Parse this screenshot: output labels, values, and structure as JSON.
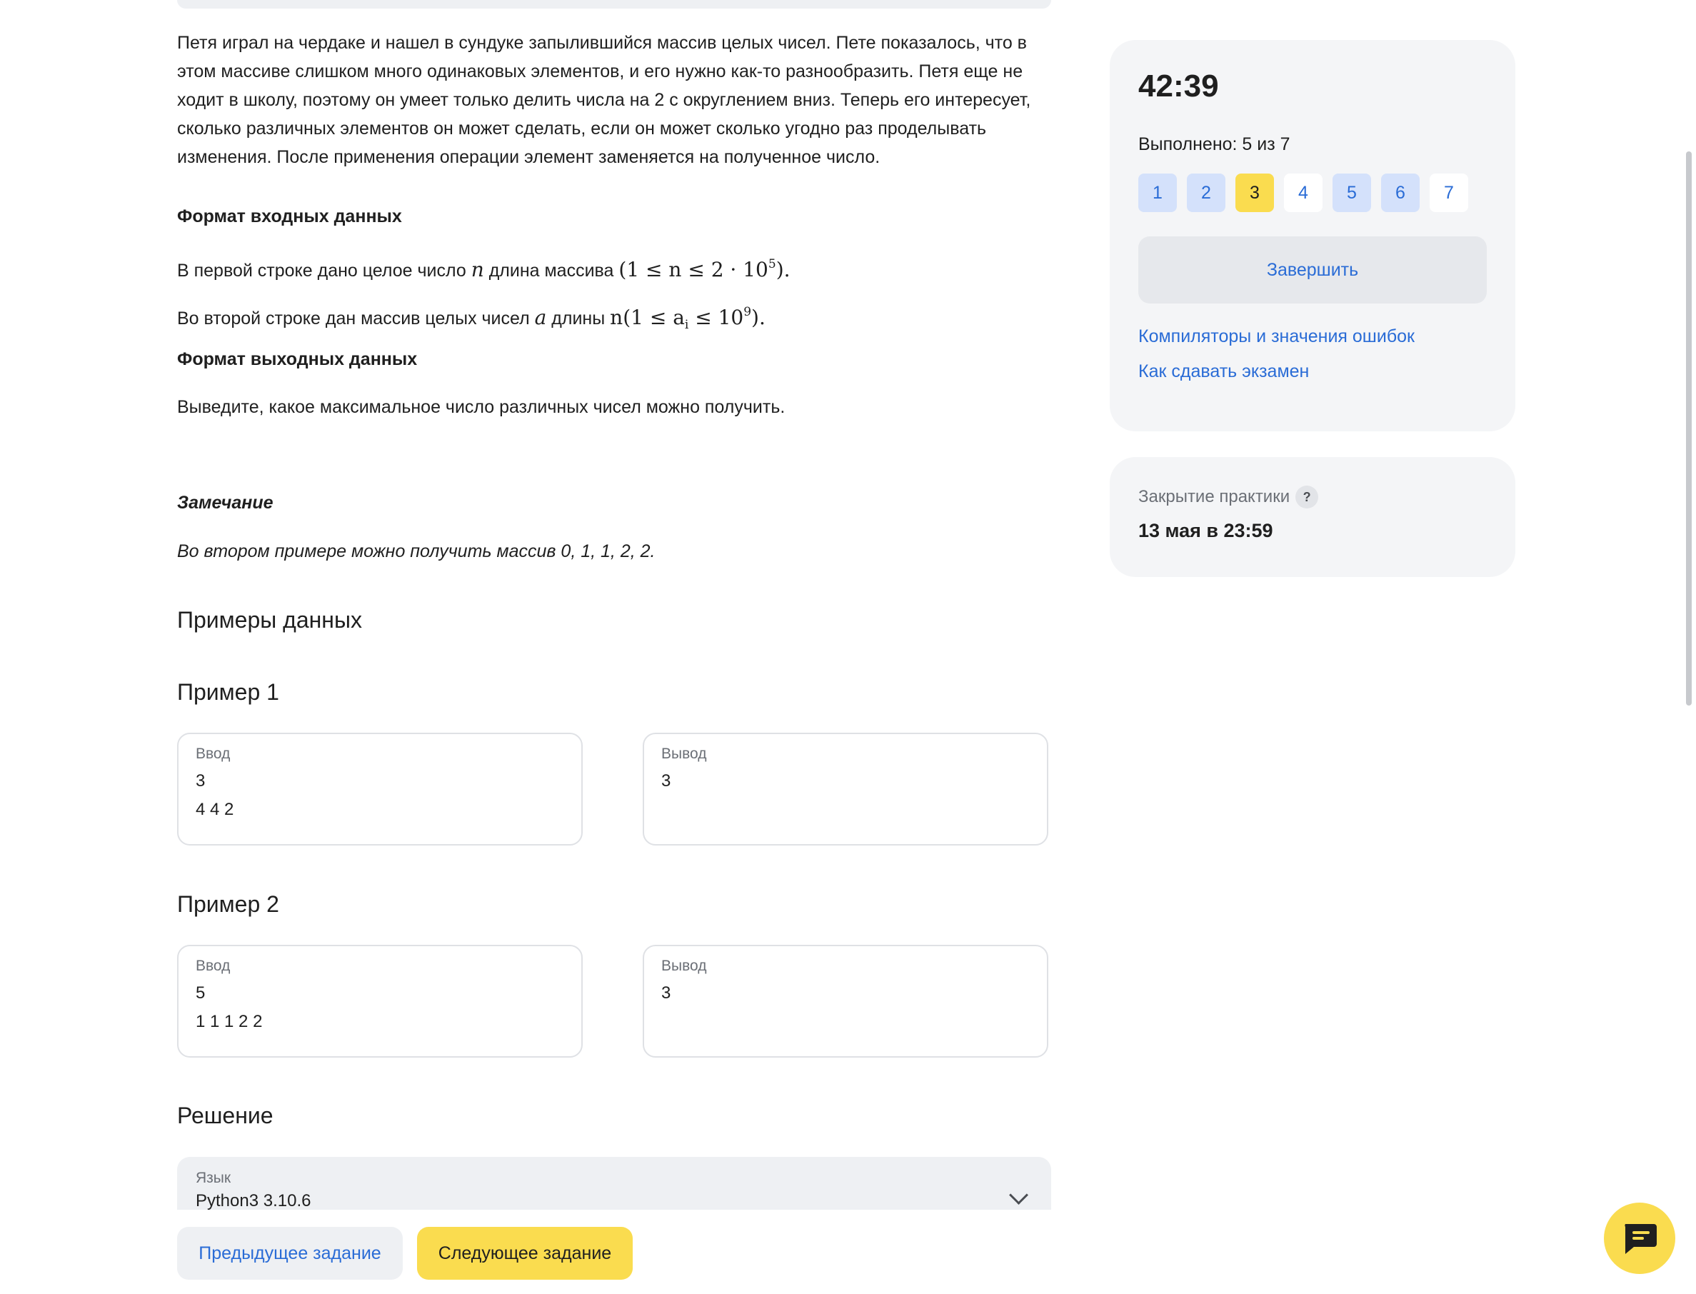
{
  "problem": {
    "statement_lines": [
      "Петя играл на чердаке и нашел в сундуке запылившийся массив целых чисел. Пете показалось, что в",
      "этом массиве слишком много одинаковых элементов, и его нужно как-то разнообразить. Петя еще не",
      "ходит в школу, поэтому он умеет только делить числа на 2 с округлением вниз. Теперь его интересует,",
      "сколько различных элементов он может сделать, если он может сколько угодно раз проделывать",
      "изменения. После применения операции элемент заменяется на полученное число."
    ],
    "input_format_title": "Формат входных данных",
    "input_line1_prefix": "В первой строке дано целое число",
    "input_line1_var": "n",
    "input_line1_mid": "длина массива",
    "input_line1_math": "(1 ≤ n ≤ 2 · 10",
    "input_line1_exp": "5",
    "input_line1_end": ").",
    "input_line2_prefix": "Во второй строке дан массив целых чисел",
    "input_line2_var": "a",
    "input_line2_mid": "длины",
    "input_line2_math": "n(1 ≤ a",
    "input_line2_sub": "i",
    "input_line2_math2": " ≤ 10",
    "input_line2_exp": "9",
    "input_line2_end": ").",
    "output_format_title": "Формат выходных данных",
    "output_line": "Выведите, какое максимальное число различных чисел можно получить.",
    "note_title": "Замечание",
    "note_text": "Во втором примере можно получить массив 0, 1, 1, 2, 2."
  },
  "examples": {
    "section_title": "Примеры данных",
    "input_label": "Ввод",
    "output_label": "Вывод",
    "items": [
      {
        "title": "Пример 1",
        "input_lines": [
          "3",
          "4 4 2"
        ],
        "output_lines": [
          "3"
        ]
      },
      {
        "title": "Пример 2",
        "input_lines": [
          "5",
          "1 1 1 2 2"
        ],
        "output_lines": [
          "3"
        ]
      }
    ]
  },
  "solution": {
    "title": "Решение",
    "language_label": "Язык",
    "language_value": "Python3 3.10.6"
  },
  "nav": {
    "prev_label": "Предыдущее задание",
    "next_label": "Следующее задание"
  },
  "sidebar": {
    "timer": "42:39",
    "progress_text": "Выполнено: 5 из 7",
    "tasks": [
      {
        "label": "1",
        "state": "done"
      },
      {
        "label": "2",
        "state": "done"
      },
      {
        "label": "3",
        "state": "current"
      },
      {
        "label": "4",
        "state": "todo"
      },
      {
        "label": "5",
        "state": "done"
      },
      {
        "label": "6",
        "state": "done"
      },
      {
        "label": "7",
        "state": "todo"
      }
    ],
    "finish_label": "Завершить",
    "link_compilers": "Компиляторы и значения ошибок",
    "link_how_to": "Как сдавать экзамен",
    "close_label": "Закрытие практики",
    "close_help": "?",
    "close_date": "13 мая в 23:59"
  },
  "colors": {
    "accent_yellow": "#fadc4f",
    "link_blue": "#2a6cd6",
    "done_task_bg": "#d4e1fb",
    "card_bg": "#f4f5f7"
  },
  "icons": {
    "chat": "chat-bubble-icon",
    "language_dropdown": "chevron-down-icon",
    "help": "question-icon"
  }
}
